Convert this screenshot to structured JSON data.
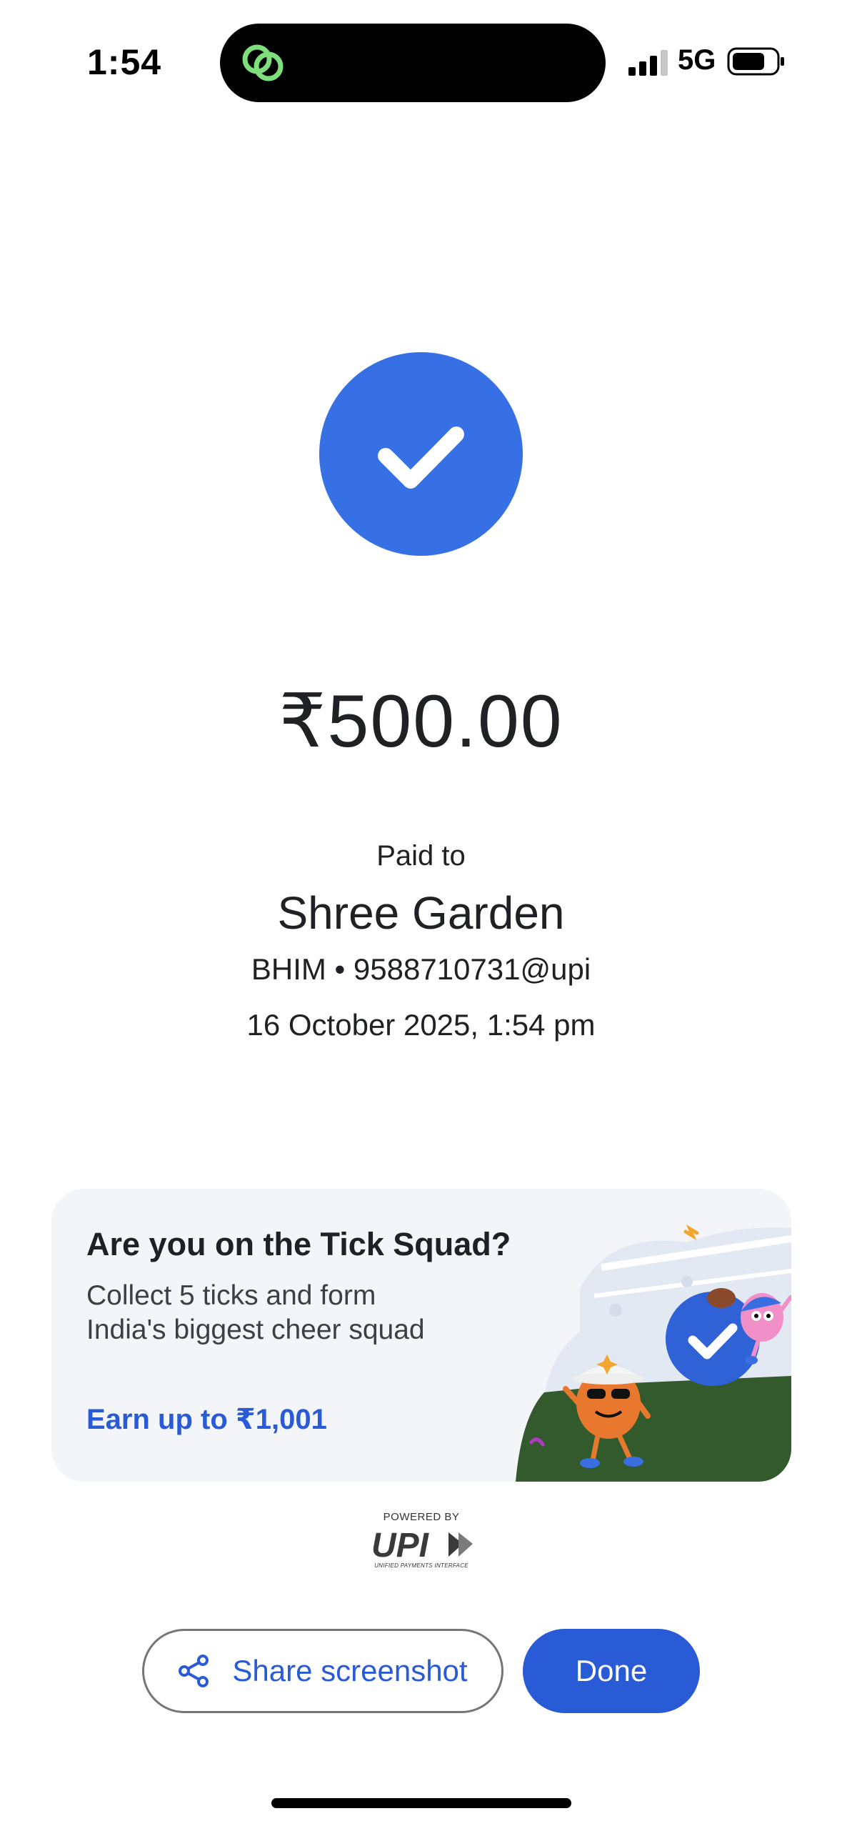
{
  "status_bar": {
    "time": "1:54",
    "network": "5G",
    "signal_bars": 3,
    "signal_bars_total": 4
  },
  "icons": {
    "island": "green-link-icon",
    "success": "checkmark-icon",
    "share": "share-icon"
  },
  "colors": {
    "accent": "#2a5bd7",
    "success_circle": "#3670e4",
    "island_icon": "#7ee07c",
    "card_bg": "#f3f5f9",
    "grass": "#335a2c"
  },
  "payment": {
    "amount": "₹500.00",
    "paid_to_label": "Paid to",
    "payee": "Shree Garden",
    "upi_id": "BHIM • 9588710731@upi",
    "datetime": "16 October 2025, 1:54 pm"
  },
  "promo": {
    "title": "Are you on the Tick Squad?",
    "description_line1": "Collect 5 ticks and form",
    "description_line2": "India's biggest cheer squad",
    "cta": "Earn up to ₹1,001"
  },
  "upi_logo": {
    "powered_by": "POWERED BY",
    "mark": "UPI",
    "subtitle": "UNIFIED PAYMENTS INTERFACE"
  },
  "actions": {
    "share_label": "Share screenshot",
    "done_label": "Done"
  }
}
